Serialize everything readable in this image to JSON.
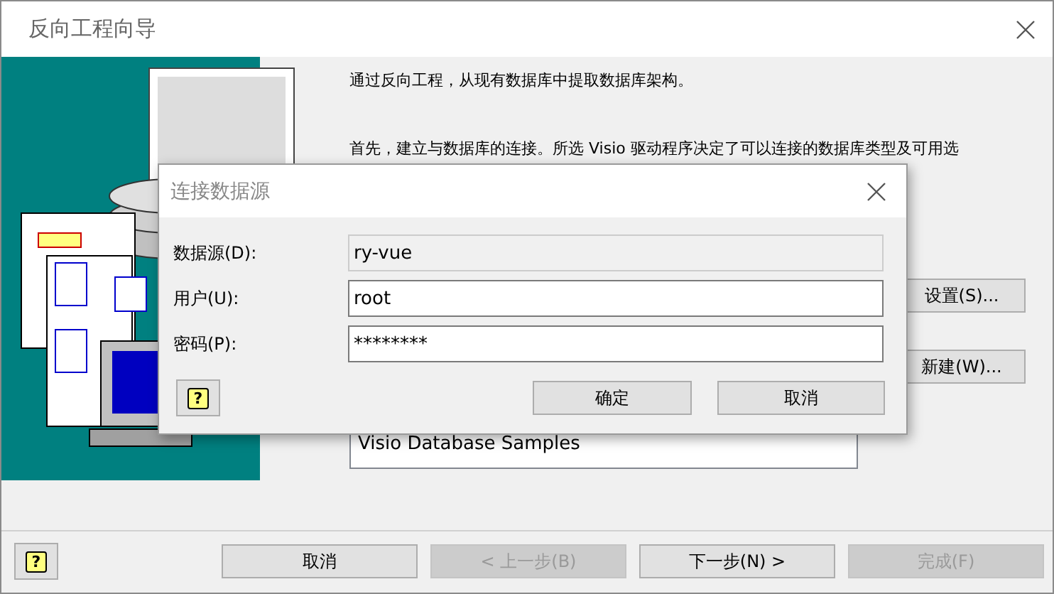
{
  "window": {
    "title": "反向工程向导"
  },
  "intro": [
    "通过反向工程，从现有数据库中提取数据库架构。",
    "首先，建立与数据库的连接。所选 Visio 驱动程序决定了可以连接的数据库类型及可用选"
  ],
  "side_buttons": [
    {
      "label": "设置(S)..."
    },
    {
      "label": "新建(W)..."
    }
  ],
  "source_list": {
    "items": [
      "Visio Database Samples"
    ]
  },
  "footer_buttons": [
    {
      "kind": "help",
      "label": "?",
      "disabled": false
    },
    {
      "kind": "text",
      "label": "取消",
      "disabled": false
    },
    {
      "kind": "text",
      "label": "< 上一步(B)",
      "disabled": true
    },
    {
      "kind": "text",
      "label": "下一步(N) >",
      "disabled": false
    },
    {
      "kind": "text",
      "label": "完成(F)",
      "disabled": true
    }
  ],
  "dialog": {
    "title": "连接数据源",
    "fields": [
      {
        "label": "数据源(D):",
        "value": "ry-vue",
        "disabled": true
      },
      {
        "label": "用户(U):",
        "value": "root",
        "disabled": false
      },
      {
        "label": "密码(P):",
        "value": "********",
        "disabled": false
      }
    ],
    "buttons": [
      {
        "kind": "help",
        "label": "?",
        "disabled": false
      },
      {
        "kind": "text",
        "label": "确定",
        "disabled": false
      },
      {
        "kind": "text",
        "label": "取消",
        "disabled": false
      }
    ]
  }
}
